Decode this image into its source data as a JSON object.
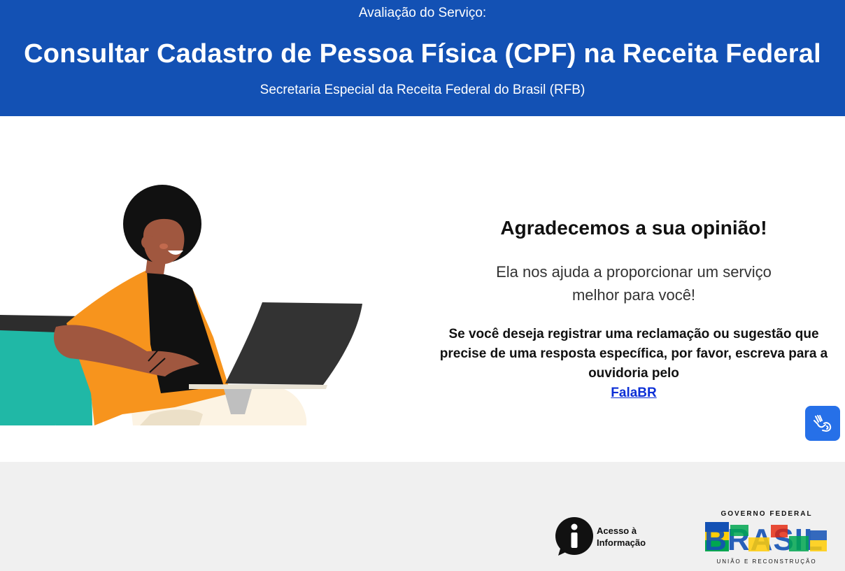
{
  "header": {
    "kicker": "Avaliação do Serviço:",
    "title": "Consultar Cadastro de Pessoa Física (CPF) na Receita Federal",
    "subtitle": "Secretaria Especial da Receita Federal do Brasil (RFB)"
  },
  "thanks": {
    "heading": "Agradecemos a sua opinião!",
    "line1": "Ela nos ajuda a proporcionar um serviço",
    "line2": "melhor para você!",
    "instructions": "Se você deseja registrar uma reclamação ou sugestão que precise de uma resposta específica, por favor, escreva para a ouvidoria pelo",
    "link_label": "FalaBR"
  },
  "accessibility": {
    "icon": "hand-sign-language-icon"
  },
  "footer": {
    "acesso_line1": "Acesso à",
    "acesso_line2": "Informação",
    "gov_top": "GOVERNO FEDERAL",
    "gov_brand": "BRASIL",
    "gov_bottom": "UNIÃO E RECONSTRUÇÃO"
  },
  "colors": {
    "header_bg": "#1351b4",
    "link": "#0c2fd6",
    "footer_bg": "#f0f0f0",
    "libras_button": "#2670e8"
  }
}
